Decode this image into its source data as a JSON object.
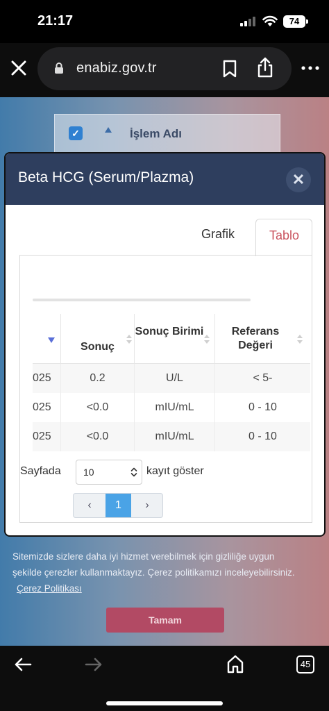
{
  "status_bar": {
    "time": "21:17",
    "battery": "74"
  },
  "browser": {
    "url": "enabiz.gov.tr",
    "icons": [
      "close-icon",
      "lock-icon",
      "bookmark-icon",
      "share-icon",
      "more-icon"
    ]
  },
  "background_page": {
    "column_label": "İşlem Adı",
    "checkbox_checked": true
  },
  "modal": {
    "title": "Beta HCG (Serum/Plazma)",
    "close_glyph": "✕",
    "tabs": [
      {
        "label": "Grafik",
        "active": false
      },
      {
        "label": "Tablo",
        "active": true
      }
    ],
    "table": {
      "columns": [
        {
          "label": "",
          "sort": "desc"
        },
        {
          "label": "Sonuç",
          "sort": "none"
        },
        {
          "label": "Sonuç Birimi",
          "sort": "none"
        },
        {
          "label": "Referans Değeri",
          "sort": "none"
        }
      ],
      "rows": [
        {
          "date": "025",
          "result": "0.2",
          "unit": "U/L",
          "reference": "< 5-"
        },
        {
          "date": "025",
          "result": "<0.0",
          "unit": "mIU/mL",
          "reference": "0 - 10"
        },
        {
          "date": "025",
          "result": "<0.0",
          "unit": "mIU/mL",
          "reference": "0 - 10"
        }
      ]
    },
    "length_menu": {
      "prefix": "Sayfada",
      "value": "10",
      "suffix": "kayıt göster"
    },
    "pagination": {
      "prev": "‹",
      "current": "1",
      "next": "›"
    }
  },
  "cookie_banner": {
    "text": "Sitemizde sizlere daha iyi hizmet verebilmek için gizliliğe uygun şekilde çerezler kullanmaktayız. Çerez politikamızı inceleyebilirsiniz.",
    "link": "Çerez Politikası",
    "button": "Tamam"
  },
  "bottom_bar": {
    "tab_count": "45",
    "icons": [
      "back-arrow-icon",
      "forward-arrow-icon",
      "home-icon",
      "tabs-icon"
    ]
  },
  "colors": {
    "modal_header": "#2e3e5e",
    "active_tab": "#c9535e",
    "pager_active": "#4aa3e6",
    "cookie_button": "#b24a64"
  }
}
